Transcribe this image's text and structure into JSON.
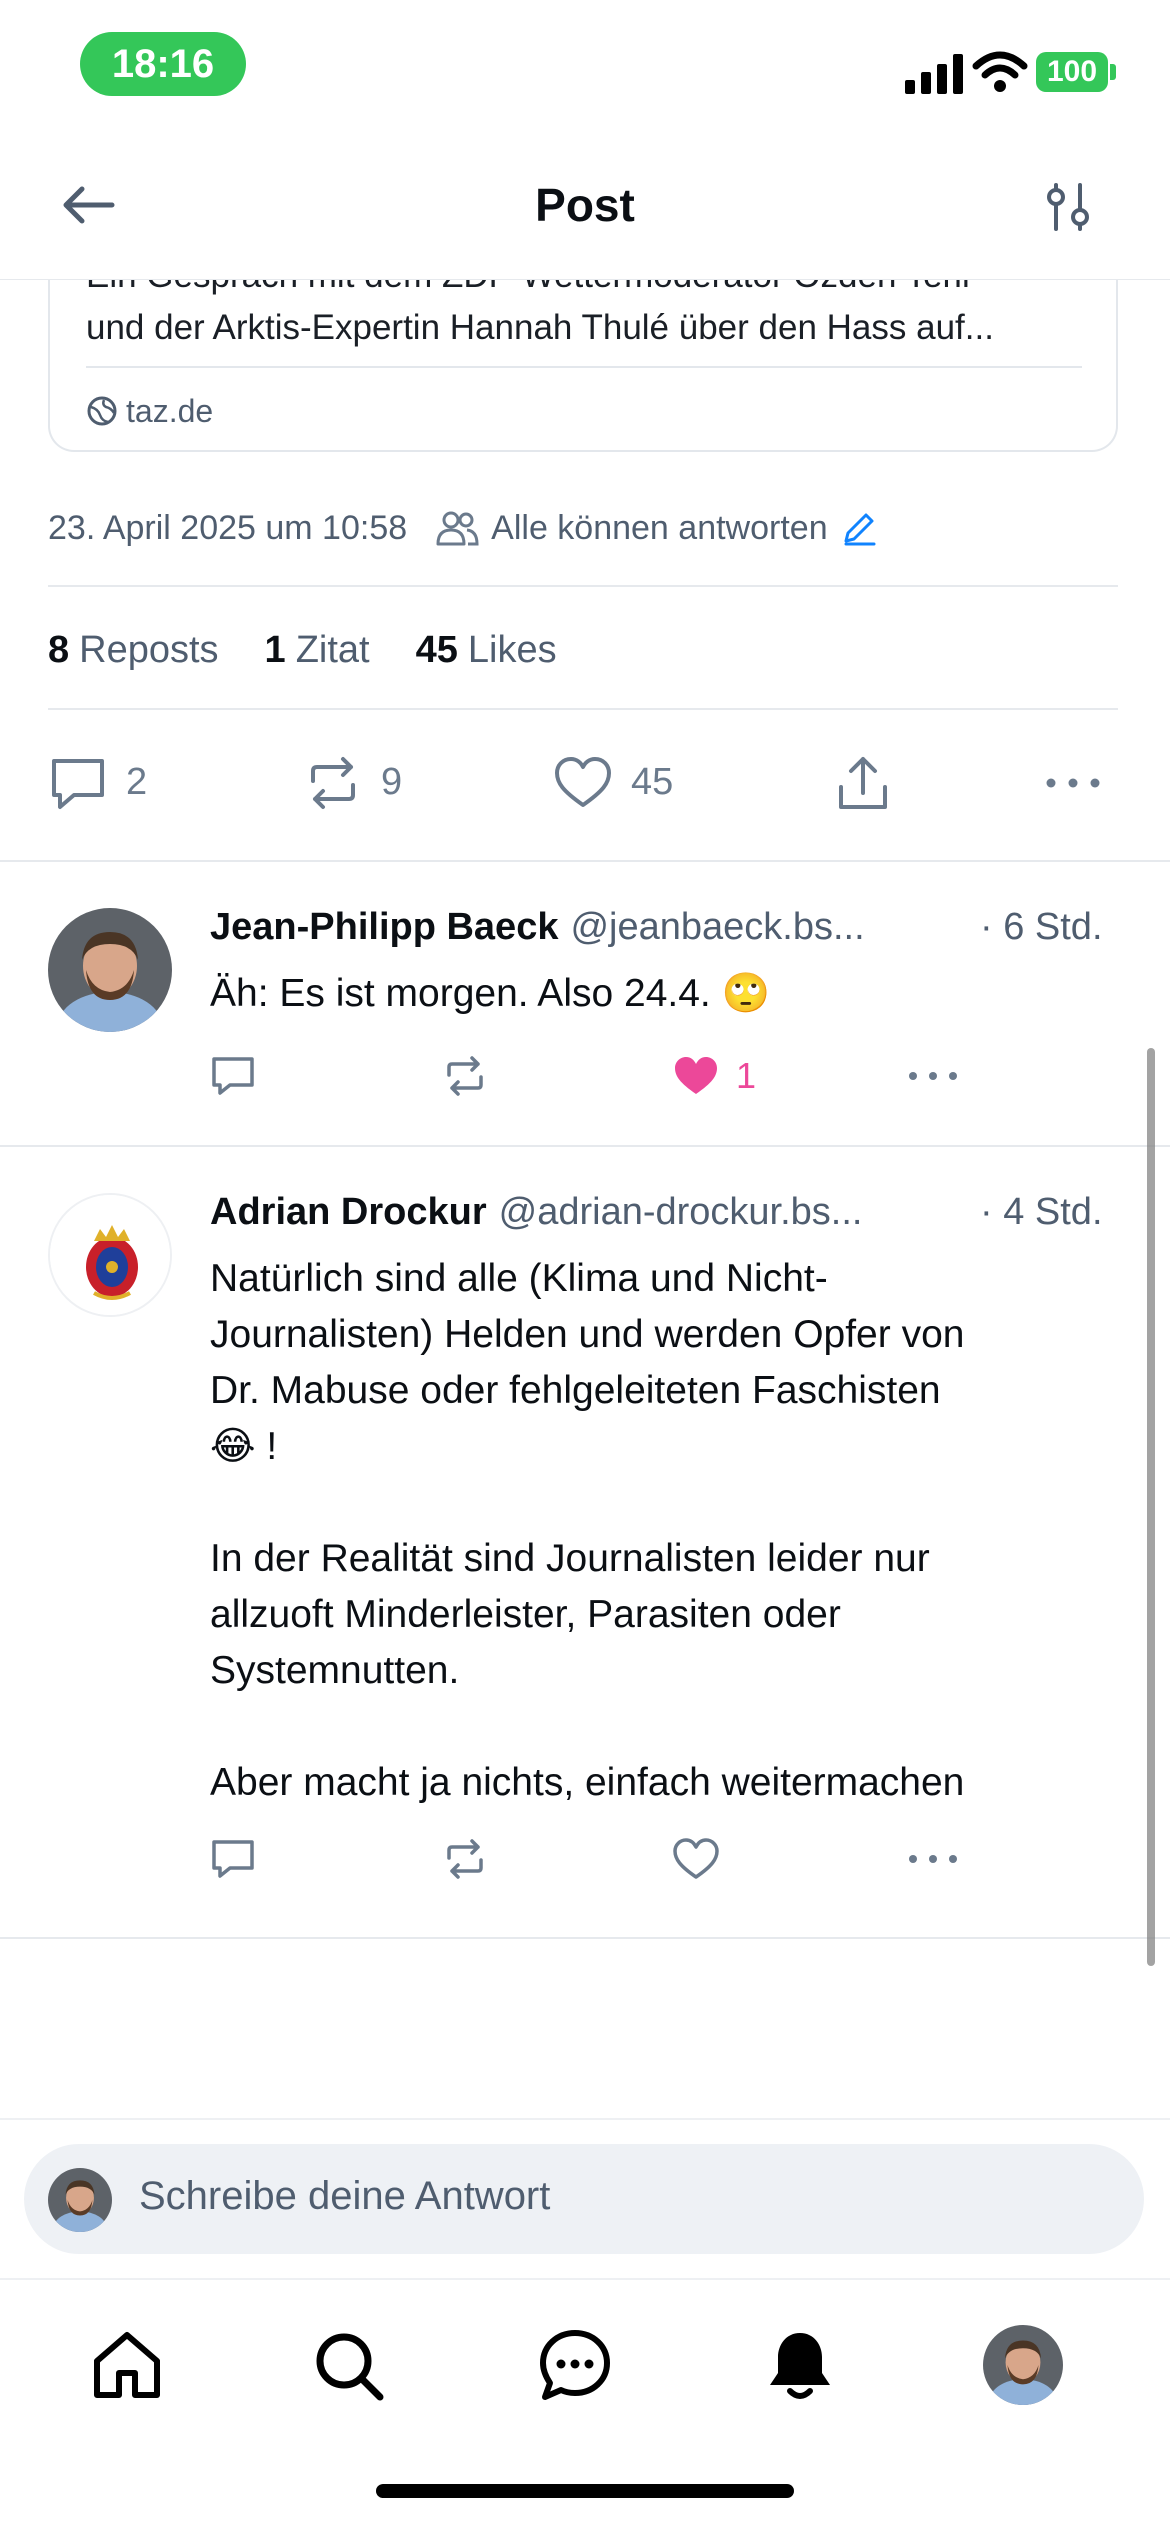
{
  "status_bar": {
    "time": "18:16",
    "battery": "100"
  },
  "header": {
    "title": "Post",
    "back_icon": "arrow-left-icon",
    "filter_icon": "sliders-icon"
  },
  "link_card": {
    "description_partial_top": "Ein Gespräch mit dem ZDF-Wettermoderator Özden Terli",
    "description_line2": "und der Arktis-Expertin Hannah Thulé über den Hass auf...",
    "domain": "taz.de"
  },
  "meta": {
    "date": "23. April 2025 um 10:58",
    "reply_setting": "Alle können antworten"
  },
  "stats": {
    "reposts_count": "8",
    "reposts_label": "Reposts",
    "quotes_count": "1",
    "quotes_label": "Zitat",
    "likes_count": "45",
    "likes_label": "Likes"
  },
  "actions": {
    "replies": "2",
    "reposts": "9",
    "likes": "45"
  },
  "replies": [
    {
      "name": "Jean-Philipp Baeck",
      "handle": "@jeanbaeck.bs...",
      "time": "· 6 Std.",
      "text": "Äh: Es ist morgen. Also 24.4.  🙄",
      "likes": "1",
      "liked": true
    },
    {
      "name": "Adrian Drockur",
      "handle": "@adrian-drockur.bs...",
      "time": "· 4 Std.",
      "text": "Natürlich sind alle (Klima und Nicht-\nJournalisten) Helden und werden Opfer von\nDr. Mabuse oder fehlgeleiteten Faschisten\n😂 !\n\nIn der Realität sind Journalisten leider nur\nallzuoft Minderleister, Parasiten oder\nSystemnutten.\n\nAber macht ja nichts, einfach weitermachen",
      "likes": "",
      "liked": false
    }
  ],
  "composer": {
    "placeholder": "Schreibe deine Antwort"
  },
  "colors": {
    "accent": "#1083fe",
    "like": "#ec4899",
    "muted": "#4f5d6f",
    "status_green": "#34c759"
  }
}
